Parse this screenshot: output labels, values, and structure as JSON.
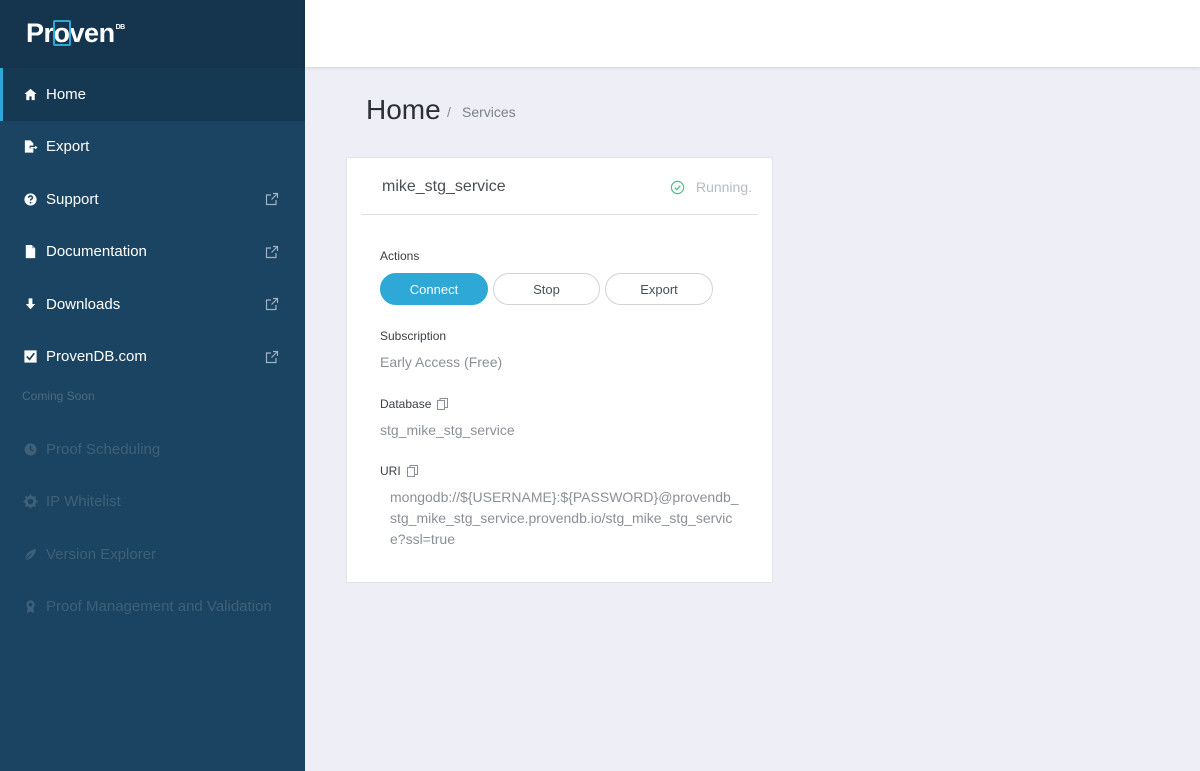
{
  "brand": {
    "name_pre": "Pr",
    "name_o": "o",
    "name_post": "ven",
    "superscript": "DB",
    "accent": "#2ea8d6"
  },
  "sidebar": {
    "items": [
      {
        "label": "Home",
        "icon": "home-icon",
        "external": false,
        "active": true
      },
      {
        "label": "Export",
        "icon": "export-icon",
        "external": false
      },
      {
        "label": "Support",
        "icon": "question-icon",
        "external": true
      },
      {
        "label": "Documentation",
        "icon": "document-icon",
        "external": true
      },
      {
        "label": "Downloads",
        "icon": "download-icon",
        "external": true
      },
      {
        "label": "ProvenDB.com",
        "icon": "checkbox-icon",
        "external": true
      }
    ],
    "coming_soon_label": "Coming Soon",
    "coming_soon_items": [
      {
        "label": "Proof Scheduling",
        "icon": "clock-icon"
      },
      {
        "label": "IP Whitelist",
        "icon": "gear-icon"
      },
      {
        "label": "Version Explorer",
        "icon": "leaf-icon"
      },
      {
        "label": "Proof Management and Validation",
        "icon": "award-icon"
      }
    ]
  },
  "page": {
    "title": "Home",
    "separator": "/",
    "breadcrumb": "Services"
  },
  "service": {
    "name": "mike_stg_service",
    "status": "Running.",
    "status_color": "#4fc08d",
    "actions_label": "Actions",
    "actions": {
      "connect": "Connect",
      "stop": "Stop",
      "export": "Export"
    },
    "subscription_label": "Subscription",
    "subscription_value": "Early Access (Free)",
    "database_label": "Database",
    "database_value": "stg_mike_stg_service",
    "uri_label": "URI",
    "uri_value": "mongodb://${USERNAME}:${PASSWORD}@provendb_stg_mike_stg_service.provendb.io/stg_mike_stg_service?ssl=true"
  }
}
